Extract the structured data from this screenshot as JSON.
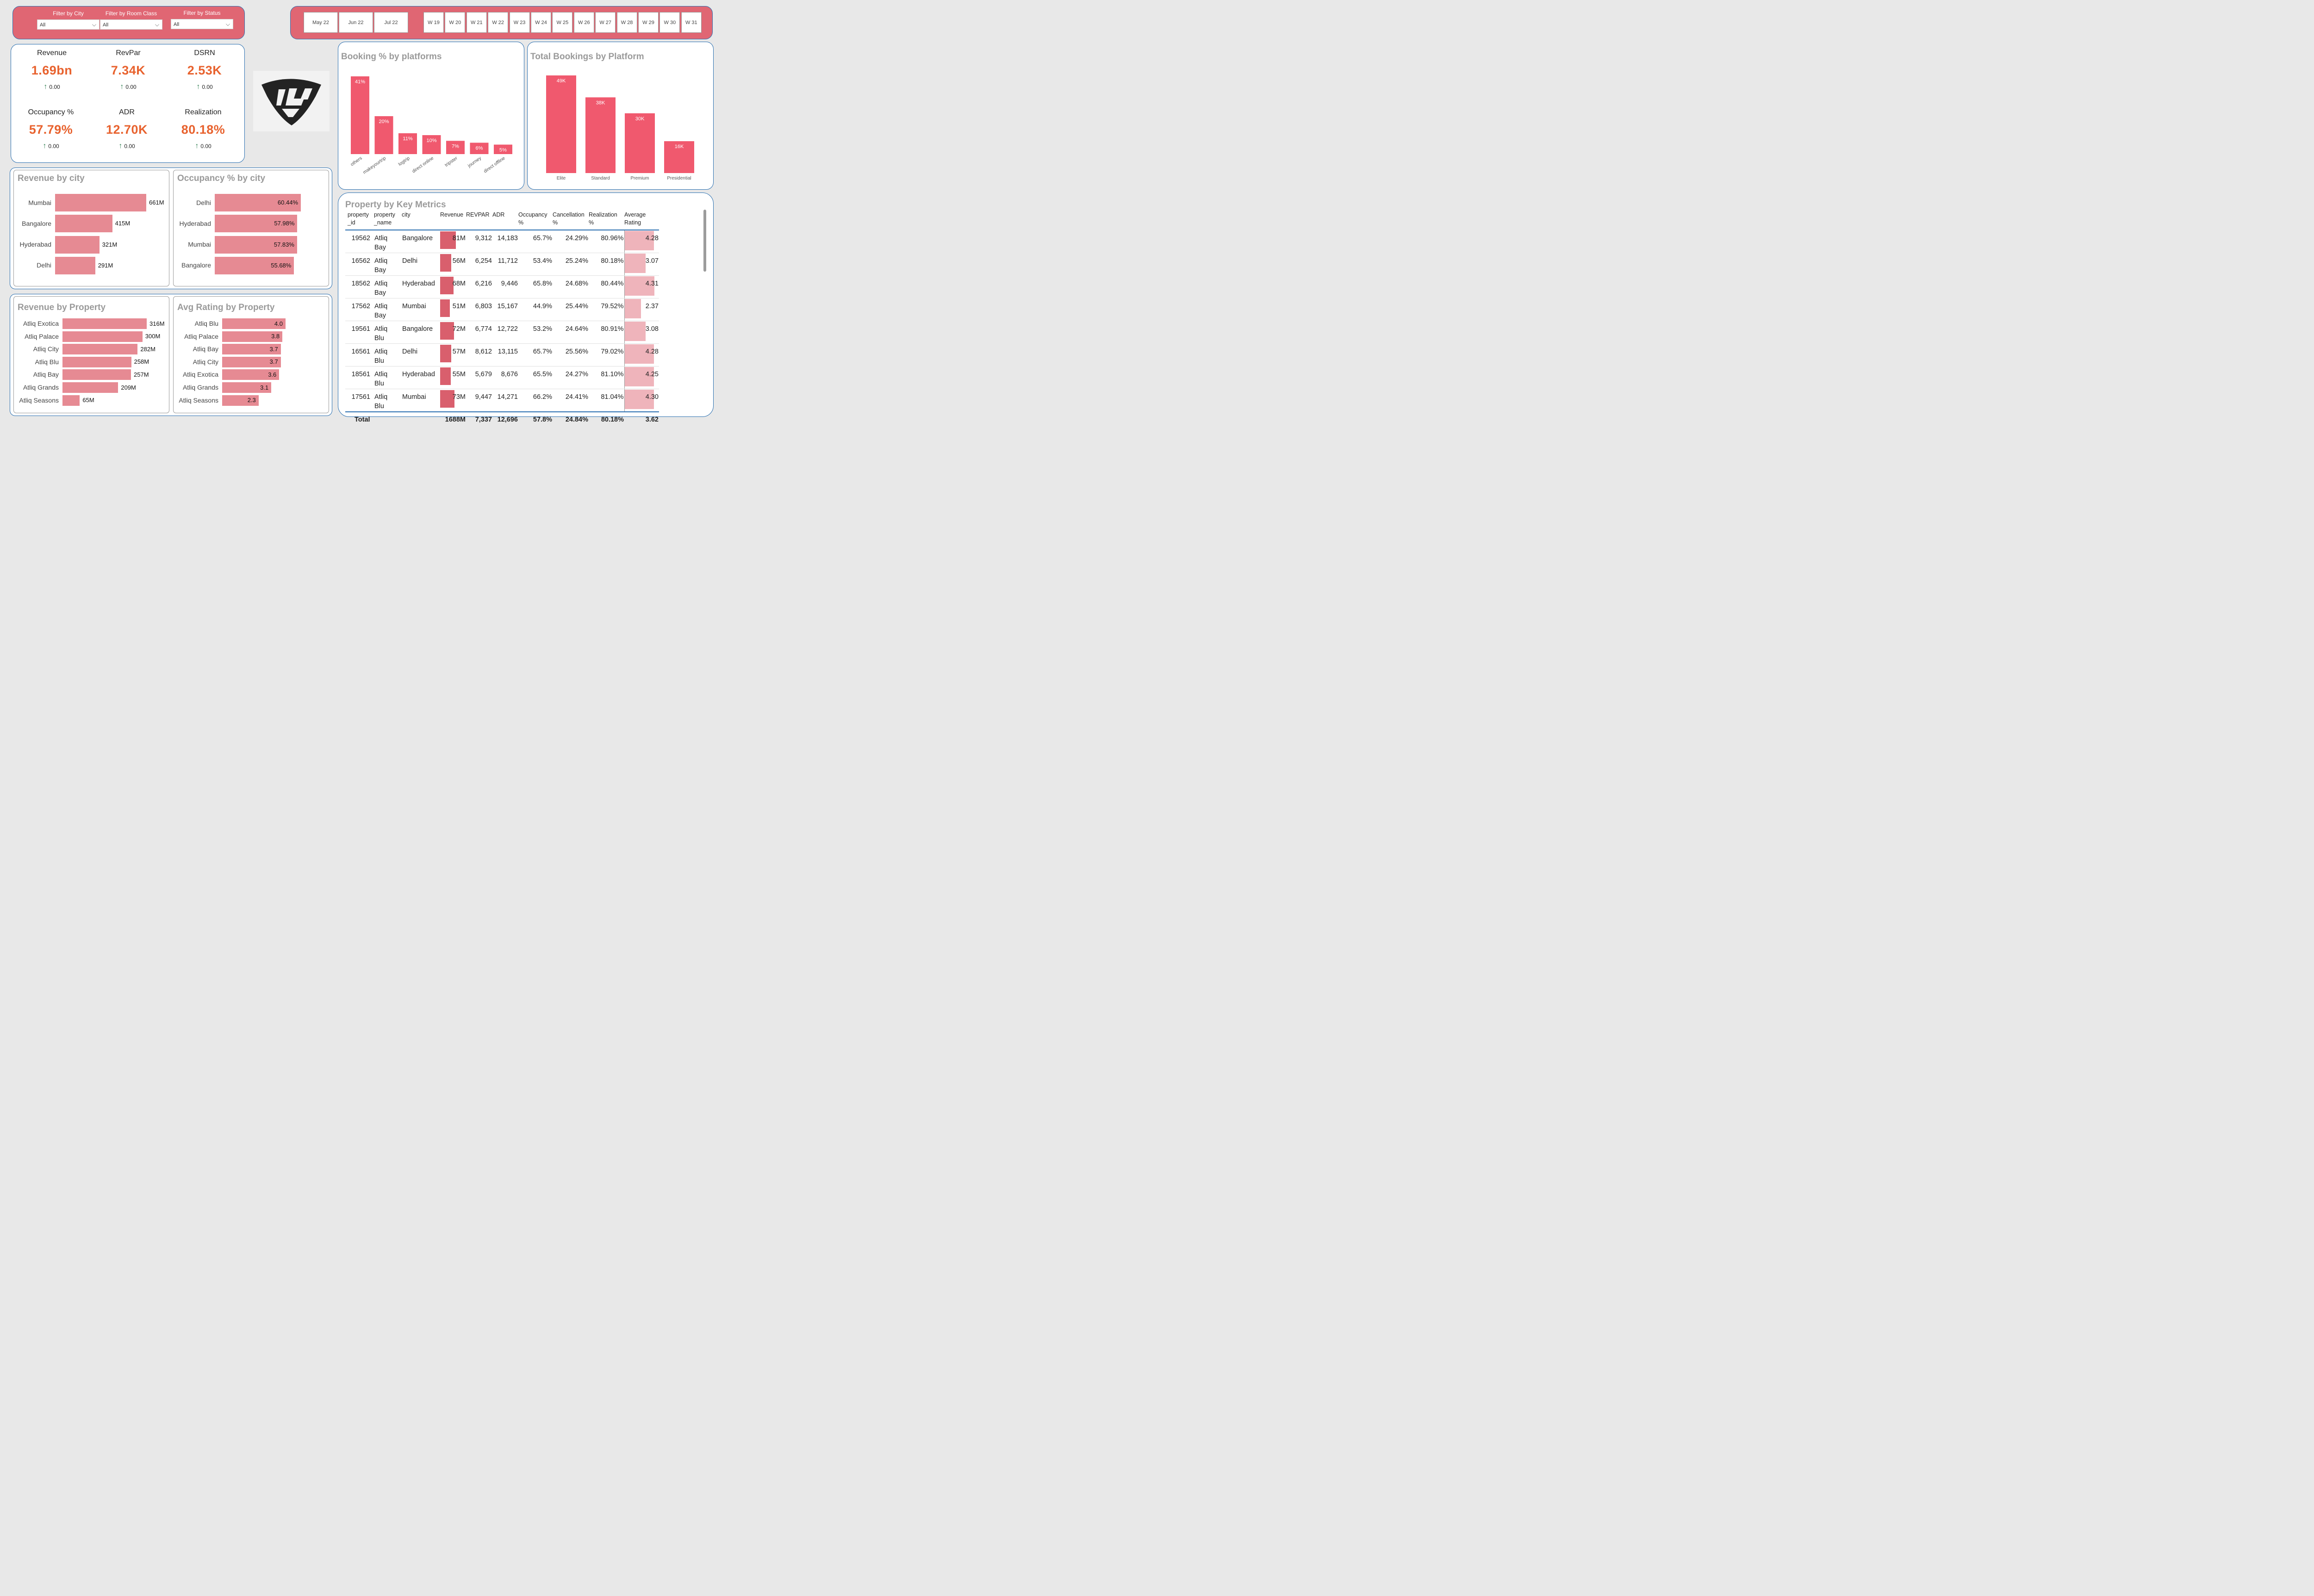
{
  "filters": [
    {
      "label": "Filter by City",
      "value": "All"
    },
    {
      "label": "Filter by Room Class",
      "value": "All"
    },
    {
      "label": "Filter by Status",
      "value": "All"
    }
  ],
  "months": [
    "May 22",
    "Jun 22",
    "Jul 22"
  ],
  "weeks": [
    "W 19",
    "W 20",
    "W 21",
    "W 22",
    "W 23",
    "W 24",
    "W 25",
    "W 26",
    "W 27",
    "W 28",
    "W 29",
    "W 30",
    "W 31"
  ],
  "kpis": [
    {
      "label": "Revenue",
      "value": "1.69bn",
      "delta": "0.00"
    },
    {
      "label": "RevPar",
      "value": "7.34K",
      "delta": "0.00"
    },
    {
      "label": "DSRN",
      "value": "2.53K",
      "delta": "0.00"
    },
    {
      "label": "Occupancy %",
      "value": "57.79%",
      "delta": "0.00"
    },
    {
      "label": "ADR",
      "value": "12.70K",
      "delta": "0.00"
    },
    {
      "label": "Realization",
      "value": "80.18%",
      "delta": "0.00"
    }
  ],
  "colors": {
    "accent": "#e8622e",
    "bar": "#f0596e",
    "hbar": "#e68a93",
    "border": "#2a6fb0",
    "up": "#2e7d4f"
  },
  "chart_data": [
    {
      "type": "bar",
      "title": "Booking % by platforms",
      "categories": [
        "others",
        "makeyourtrip",
        "logtrip",
        "direct online",
        "tripster",
        "journey",
        "direct offline"
      ],
      "values": [
        41,
        20,
        11,
        10,
        7,
        6,
        5
      ],
      "labels": [
        "41%",
        "20%",
        "11%",
        "10%",
        "7%",
        "6%",
        "5%"
      ]
    },
    {
      "type": "bar",
      "title": "Total Bookings by Platform",
      "categories": [
        "Elite",
        "Standard",
        "Premium",
        "Presidential"
      ],
      "values": [
        49,
        38,
        30,
        16
      ],
      "labels": [
        "49K",
        "38K",
        "30K",
        "16K"
      ]
    },
    {
      "type": "bar",
      "title": "Revenue by city",
      "categories": [
        "Mumbai",
        "Bangalore",
        "Hyderabad",
        "Delhi"
      ],
      "values": [
        661,
        415,
        321,
        291
      ],
      "labels": [
        "661M",
        "415M",
        "321M",
        "291M"
      ]
    },
    {
      "type": "bar",
      "title": "Occupancy % by city",
      "categories": [
        "Delhi",
        "Hyderabad",
        "Mumbai",
        "Bangalore"
      ],
      "values": [
        60.44,
        57.98,
        57.83,
        55.68
      ],
      "labels": [
        "60.44%",
        "57.98%",
        "57.83%",
        "55.68%"
      ]
    },
    {
      "type": "bar",
      "title": "Revenue by Property",
      "categories": [
        "Atliq Exotica",
        "Atliq Palace",
        "Atliq City",
        "Atliq Blu",
        "Atliq Bay",
        "Atliq Grands",
        "Atliq Seasons"
      ],
      "values": [
        316,
        300,
        282,
        258,
        257,
        209,
        65
      ],
      "labels": [
        "316M",
        "300M",
        "282M",
        "258M",
        "257M",
        "209M",
        "65M"
      ]
    },
    {
      "type": "bar",
      "title": "Avg Rating by Property",
      "categories": [
        "Atliq Blu",
        "Atliq Palace",
        "Atliq Bay",
        "Atliq City",
        "Atliq Exotica",
        "Atliq Grands",
        "Atliq Seasons"
      ],
      "values": [
        4.0,
        3.8,
        3.7,
        3.7,
        3.6,
        3.1,
        2.3
      ],
      "labels": [
        "4.0",
        "3.8",
        "3.7",
        "3.7",
        "3.6",
        "3.1",
        "2.3"
      ]
    },
    {
      "type": "table",
      "title": "Property by Key Metrics",
      "columns": [
        "property\n_id",
        "property\n_name",
        "city",
        "Revenue",
        "REVPAR",
        "ADR",
        "Occupancy\n%",
        "Cancellation\n%",
        "Realization\n%",
        "Average\nRating"
      ],
      "rows": [
        {
          "id": "19562",
          "name": "Atliq Bay",
          "city": "Bangalore",
          "revenue": "81M",
          "rev_value": 81,
          "revpar": "9,312",
          "adr": "14,183",
          "occ": "65.7%",
          "cancel": "24.29%",
          "real": "80.96%",
          "rating": "4.28",
          "rating_value": 4.28
        },
        {
          "id": "16562",
          "name": "Atliq Bay",
          "city": "Delhi",
          "revenue": "56M",
          "rev_value": 56,
          "revpar": "6,254",
          "adr": "11,712",
          "occ": "53.4%",
          "cancel": "25.24%",
          "real": "80.18%",
          "rating": "3.07",
          "rating_value": 3.07
        },
        {
          "id": "18562",
          "name": "Atliq Bay",
          "city": "Hyderabad",
          "revenue": "68M",
          "rev_value": 68,
          "revpar": "6,216",
          "adr": "9,446",
          "occ": "65.8%",
          "cancel": "24.68%",
          "real": "80.44%",
          "rating": "4.31",
          "rating_value": 4.31
        },
        {
          "id": "17562",
          "name": "Atliq Bay",
          "city": "Mumbai",
          "revenue": "51M",
          "rev_value": 51,
          "revpar": "6,803",
          "adr": "15,167",
          "occ": "44.9%",
          "cancel": "25.44%",
          "real": "79.52%",
          "rating": "2.37",
          "rating_value": 2.37
        },
        {
          "id": "19561",
          "name": "Atliq Blu",
          "city": "Bangalore",
          "revenue": "72M",
          "rev_value": 72,
          "revpar": "6,774",
          "adr": "12,722",
          "occ": "53.2%",
          "cancel": "24.64%",
          "real": "80.91%",
          "rating": "3.08",
          "rating_value": 3.08
        },
        {
          "id": "16561",
          "name": "Atliq Blu",
          "city": "Delhi",
          "revenue": "57M",
          "rev_value": 57,
          "revpar": "8,612",
          "adr": "13,115",
          "occ": "65.7%",
          "cancel": "25.56%",
          "real": "79.02%",
          "rating": "4.28",
          "rating_value": 4.28
        },
        {
          "id": "18561",
          "name": "Atliq Blu",
          "city": "Hyderabad",
          "revenue": "55M",
          "rev_value": 55,
          "revpar": "5,679",
          "adr": "8,676",
          "occ": "65.5%",
          "cancel": "24.27%",
          "real": "81.10%",
          "rating": "4.25",
          "rating_value": 4.25
        },
        {
          "id": "17561",
          "name": "Atliq Blu",
          "city": "Mumbai",
          "revenue": "73M",
          "rev_value": 73,
          "revpar": "9,447",
          "adr": "14,271",
          "occ": "66.2%",
          "cancel": "24.41%",
          "real": "81.04%",
          "rating": "4.30",
          "rating_value": 4.3
        }
      ],
      "total": {
        "label": "Total",
        "revenue": "1688M",
        "revpar": "7,337",
        "adr": "12,696",
        "occ": "57.8%",
        "cancel": "24.84%",
        "real": "80.18%",
        "rating": "3.62"
      }
    }
  ]
}
